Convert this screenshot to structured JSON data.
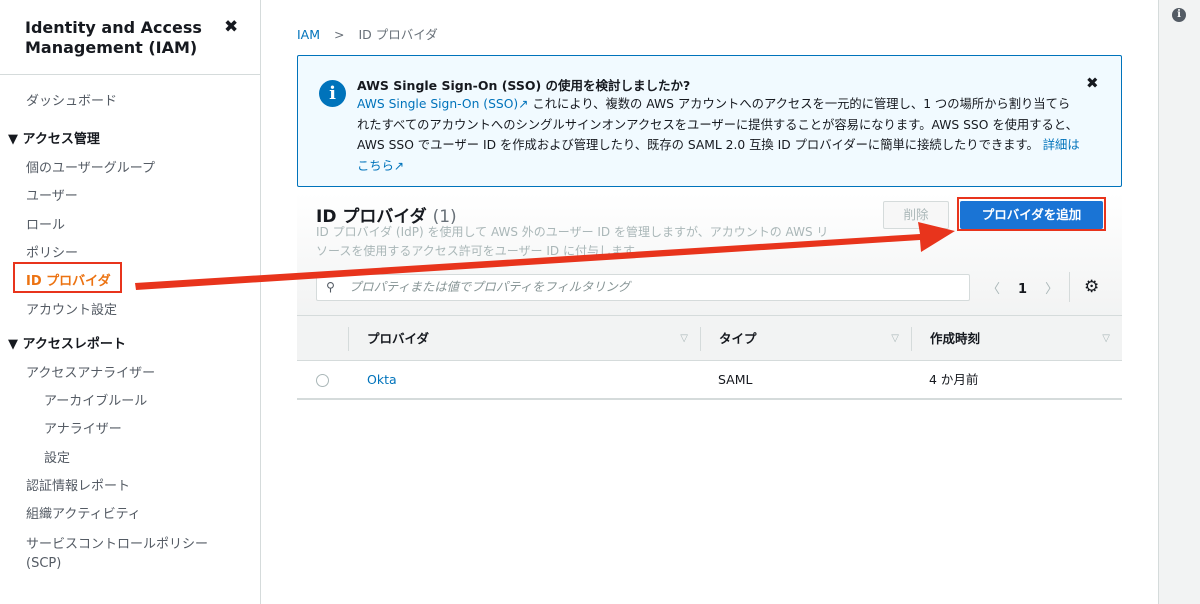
{
  "sidebar": {
    "title": "Identity and Access Management (IAM)",
    "dashboard": "ダッシュボード",
    "sec1": "アクセス管理",
    "items1": [
      "個のユーザーグループ",
      "ユーザー",
      "ロール",
      "ポリシー",
      "ID プロバイダ",
      "アカウント設定"
    ],
    "sec2": "アクセスレポート",
    "analyzer": "アクセスアナライザー",
    "analyzer_sub": [
      "アーカイブルール",
      "アナライザー",
      "設定"
    ],
    "items2": [
      "認証情報レポート",
      "組織アクティビティ",
      "サービスコントロールポリシー (SCP)"
    ]
  },
  "breadcrumb": {
    "root": "IAM",
    "sep": ">",
    "current": "ID プロバイダ"
  },
  "alert": {
    "title": "AWS Single Sign-On (SSO) の使用を検討しましたか?",
    "link": "AWS Single Sign-On (SSO)↗",
    "body": " これにより、複数の AWS アカウントへのアクセスを一元的に管理し、1 つの場所から割り当てられたすべてのアカウントへのシングルサインオンアクセスをユーザーに提供することが容易になります。AWS SSO を使用すると、AWS SSO でユーザー ID を作成および管理したり、既存の SAML 2.0 互換 ID プロバイダーに簡単に接続したりできます。 ",
    "more": "詳細はこちら↗"
  },
  "panel": {
    "title": "ID プロバイダ",
    "count": "(1)",
    "desc": "ID プロバイダ (IdP) を使用して AWS 外のユーザー ID を管理しますが、アカウントの AWS リソースを使用するアクセス許可をユーザー ID に付与します。",
    "delete": "削除",
    "add": "プロバイダを追加",
    "search_placeholder": "プロパティまたは値でプロパティをフィルタリング",
    "page": "1"
  },
  "table": {
    "columns": [
      "プロバイダ",
      "タイプ",
      "作成時刻"
    ],
    "rows": [
      {
        "name": "Okta",
        "type": "SAML",
        "created": "4 か月前"
      }
    ]
  },
  "colors": {
    "accent": "#ec7211",
    "link": "#0073bb",
    "primary": "#1a74d5",
    "annotation": "#e8341c"
  }
}
